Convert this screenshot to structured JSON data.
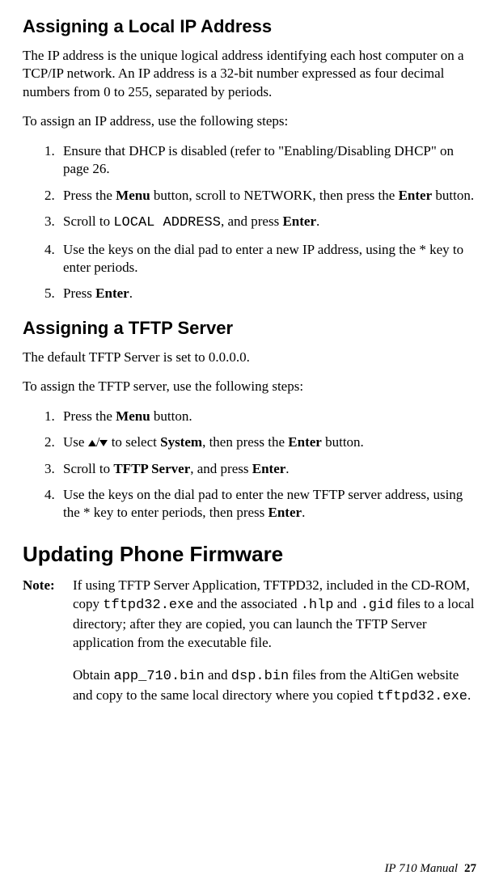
{
  "sec1": {
    "heading": "Assigning a Local IP Address",
    "intro": "The IP address is the unique logical address identifying each host computer on a TCP/IP network. An IP address is a 32-bit number expressed as four decimal numbers from 0 to 255, separated by periods.",
    "lead": "To assign an IP address, use the following steps:",
    "steps": {
      "s1": "Ensure that DHCP is disabled (refer to \"Enabling/Disabling DHCP\" on page 26.",
      "s2a": "Press the ",
      "s2b": "Menu",
      "s2c": " button, scroll to NETWORK, then press the ",
      "s2d": "Enter",
      "s2e": " button.",
      "s3a": "Scroll to ",
      "s3b": "LOCAL ADDRESS",
      "s3c": ", and press ",
      "s3d": "Enter",
      "s3e": ".",
      "s4": "Use the keys on the dial pad to enter a new IP address, using the * key to enter periods.",
      "s5a": "Press ",
      "s5b": "Enter",
      "s5c": "."
    }
  },
  "sec2": {
    "heading": "Assigning a TFTP Server",
    "intro": "The default TFTP Server is set to 0.0.0.0.",
    "lead": "To assign the TFTP server, use the following steps:",
    "steps": {
      "s1a": "Press the ",
      "s1b": "Menu",
      "s1c": " button.",
      "s2a": "Use ",
      "s2b": " to select ",
      "s2c": "System",
      "s2d": ", then press the ",
      "s2e": "Enter",
      "s2f": " button.",
      "s3a": "Scroll to ",
      "s3b": "TFTP Server",
      "s3c": ", and press ",
      "s3d": "Enter",
      "s3e": ".",
      "s4a": "Use the keys on the dial pad to enter the new TFTP server address, using the * key to enter periods, then press ",
      "s4b": "Enter",
      "s4c": "."
    }
  },
  "sec3": {
    "heading": "Updating Phone Firmware",
    "note_label": "Note:",
    "note1a": "If using TFTP Server Application, TFTPD32, included in the CD-ROM, copy ",
    "note1b": "tftpd32.exe",
    "note1c": " and the associated ",
    "note1d": ".hlp",
    "note1e": " and ",
    "note1f": ".gid",
    "note1g": " files to a local directory; after they are copied, you can launch the TFTP Server application from the executable file.",
    "note2a": "Obtain ",
    "note2b": "app_710.bin",
    "note2c": " and ",
    "note2d": "dsp.bin",
    "note2e": " files from the AltiGen website and copy to the same local directory where you copied ",
    "note2f": "tftpd32.exe",
    "note2g": "."
  },
  "footer": {
    "title": "IP 710 Manual",
    "page": "27"
  },
  "arrow_sep": "/"
}
